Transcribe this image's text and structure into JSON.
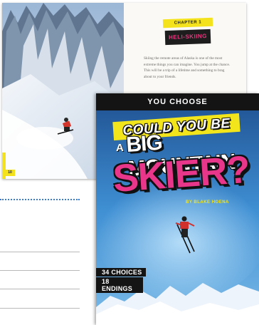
{
  "spread": {
    "chapter_label": "CHAPTER 1",
    "chapter_title": "HELI-SKIING",
    "paragraph": "Skiing the remote areas of Alaska is one of the most extreme things you can imagine. You jump at the chance. This will be a trip of a lifetime and something to brag about to your friends.",
    "page_number": "10"
  },
  "cover": {
    "series": "YOU CHOOSE",
    "title_line1": "COULD YOU BE",
    "title_a": "A",
    "title_line2": "BIG MOUNTAIN",
    "title_line3": "SKIER?",
    "author": "BY BLAKE HOENA",
    "choices": "34 CHOICES",
    "endings": "18 ENDINGS"
  },
  "colors": {
    "accent_yellow": "#f3e51b",
    "accent_pink": "#e8378a",
    "sky_blue": "#2b75b7",
    "dotted_rule": "#3a7bd5"
  }
}
